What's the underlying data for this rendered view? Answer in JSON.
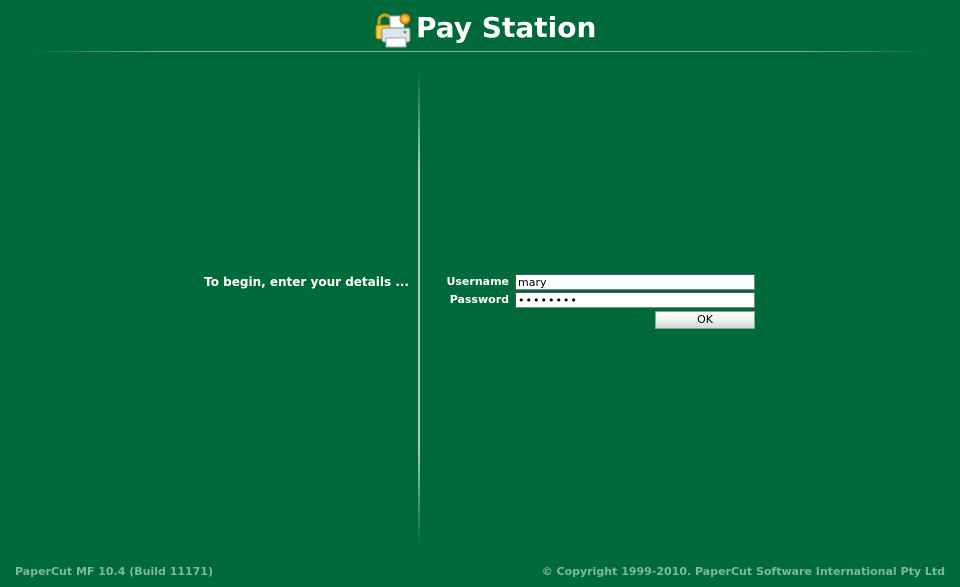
{
  "header": {
    "title": "Pay Station",
    "logo_icon": "padlock-printer-icon"
  },
  "login": {
    "prompt": "To begin, enter your details ...",
    "username_label": "Username",
    "username_value": "mary",
    "password_label": "Password",
    "password_value": "••••••••",
    "ok_label": "OK"
  },
  "footer": {
    "version": "PaperCut MF 10.4 (Build 11171)",
    "copyright": "© Copyright 1999-2010. PaperCut Software International Pty Ltd"
  },
  "colors": {
    "background": "#006a3b",
    "text": "#ffffff",
    "footer_text": "#7fb89c"
  }
}
